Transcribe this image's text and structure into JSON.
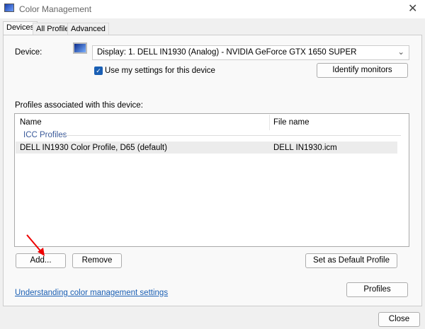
{
  "window": {
    "title": "Color Management",
    "close": "✕"
  },
  "tabs": [
    "Devices",
    "All Profiles",
    "Advanced"
  ],
  "device": {
    "label": "Device:",
    "value": "Display: 1. DELL IN1930 (Analog) - NVIDIA GeForce GTX 1650 SUPER",
    "use_settings": "Use my settings for this device",
    "identify": "Identify monitors"
  },
  "profiles": {
    "label": "Profiles associated with this device:",
    "columns": [
      "Name",
      "File name"
    ],
    "group": "ICC Profiles",
    "rows": [
      {
        "name": "DELL IN1930 Color Profile, D65 (default)",
        "file": "DELL IN1930.icm"
      }
    ]
  },
  "buttons": {
    "add": "Add...",
    "remove": "Remove",
    "set_default": "Set as Default Profile",
    "profiles": "Profiles",
    "close": "Close"
  },
  "link": "Understanding color management settings"
}
